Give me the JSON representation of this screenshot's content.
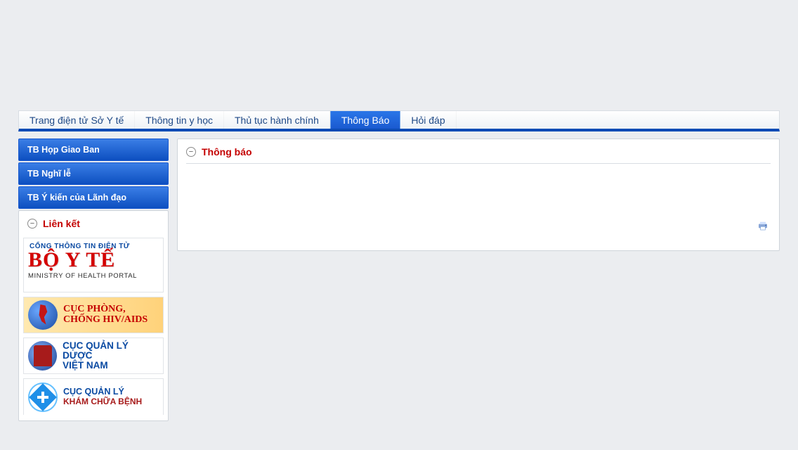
{
  "nav": {
    "items": [
      {
        "label": "Trang điện tử Sở Y tế",
        "active": false
      },
      {
        "label": "Thông tin y học",
        "active": false
      },
      {
        "label": "Thủ tục hành chính",
        "active": false
      },
      {
        "label": "Thông Báo",
        "active": true
      },
      {
        "label": "Hỏi đáp",
        "active": false
      }
    ]
  },
  "sidebar": {
    "items": [
      {
        "label": "TB Họp Giao Ban"
      },
      {
        "label": "TB Nghĩ lễ"
      },
      {
        "label": "TB Ý kiến của Lãnh đạo"
      }
    ],
    "links_title": "Liên kết",
    "banners": {
      "moh": {
        "super": "CỔNG THÔNG TIN ĐIỆN TỬ",
        "title": "BỘ Y TẾ",
        "sub": "MINISTRY OF HEALTH PORTAL"
      },
      "hiv": {
        "line1": "CỤC PHÒNG,",
        "line2": "CHỐNG HIV/AIDS"
      },
      "drug": {
        "line1": "CỤC QUẢN LÝ DƯỢC",
        "line2": "VIỆT NAM"
      },
      "kcb": {
        "line1": "CỤC QUẢN LÝ",
        "line2": "KHÁM CHỮA BỆNH"
      }
    }
  },
  "main": {
    "title": "Thông báo"
  }
}
